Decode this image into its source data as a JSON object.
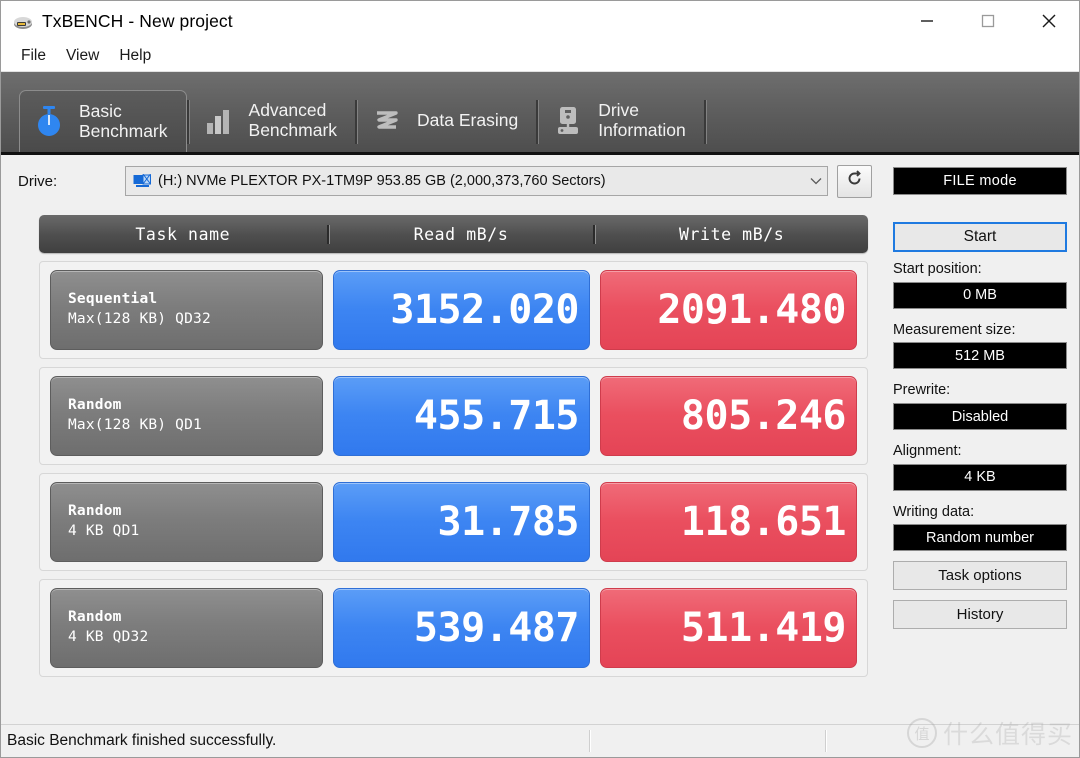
{
  "window": {
    "title": "TxBENCH - New project",
    "app_icon": "drive-app-icon",
    "minimize_label": "─",
    "maximize_label": "□",
    "close_label": "✕"
  },
  "menubar": {
    "items": [
      {
        "label": "File"
      },
      {
        "label": "View"
      },
      {
        "label": "Help"
      }
    ]
  },
  "tabs": [
    {
      "line1": "Basic",
      "line2": "Benchmark",
      "icon": "stopwatch-icon",
      "active": true
    },
    {
      "line1": "Advanced",
      "line2": "Benchmark",
      "icon": "bar-chart-icon",
      "active": false
    },
    {
      "line1": "Data Erasing",
      "line2": "",
      "icon": "eraser-wave-icon",
      "active": false
    },
    {
      "line1": "Drive",
      "line2": "Information",
      "icon": "drive-info-icon",
      "active": false
    }
  ],
  "drive": {
    "label": "Drive:",
    "selected": "(H:) NVMe PLEXTOR PX-1TM9P  953.85 GB (2,000,373,760 Sectors)",
    "icon": "drive-volume-icon",
    "dropdown_icon": "chevron-down-icon",
    "refresh_icon": "refresh-icon"
  },
  "table": {
    "headers": {
      "task": "Task name",
      "read": "Read mB/s",
      "write": "Write mB/s"
    },
    "rows": [
      {
        "name_line1": "Sequential",
        "name_line2": "Max(128 KB) QD32",
        "read": "3152.020",
        "write": "2091.480"
      },
      {
        "name_line1": "Random",
        "name_line2": "Max(128 KB) QD1",
        "read": "455.715",
        "write": "805.246"
      },
      {
        "name_line1": "Random",
        "name_line2": "4 KB QD1",
        "read": "31.785",
        "write": "118.651"
      },
      {
        "name_line1": "Random",
        "name_line2": "4 KB QD32",
        "read": "539.487",
        "write": "511.419"
      }
    ]
  },
  "sidebar": {
    "mode": "FILE mode",
    "start_button": "Start",
    "fields": [
      {
        "label": "Start position:",
        "value": "0 MB"
      },
      {
        "label": "Measurement size:",
        "value": "512 MB"
      },
      {
        "label": "Prewrite:",
        "value": "Disabled"
      },
      {
        "label": "Alignment:",
        "value": "4 KB"
      },
      {
        "label": "Writing data:",
        "value": "Random number"
      }
    ],
    "task_options_button": "Task options",
    "history_button": "History"
  },
  "statusbar": {
    "message": "Basic Benchmark finished successfully."
  },
  "watermark": {
    "logo_char": "值",
    "text": "什么值得买"
  },
  "colors": {
    "read_blue": "#3d85f2",
    "write_red": "#ea4f5f",
    "accent_blue": "#1f7ae0",
    "tab_bar": "#5e5e5e",
    "header_gray": "#4f4f4f"
  }
}
